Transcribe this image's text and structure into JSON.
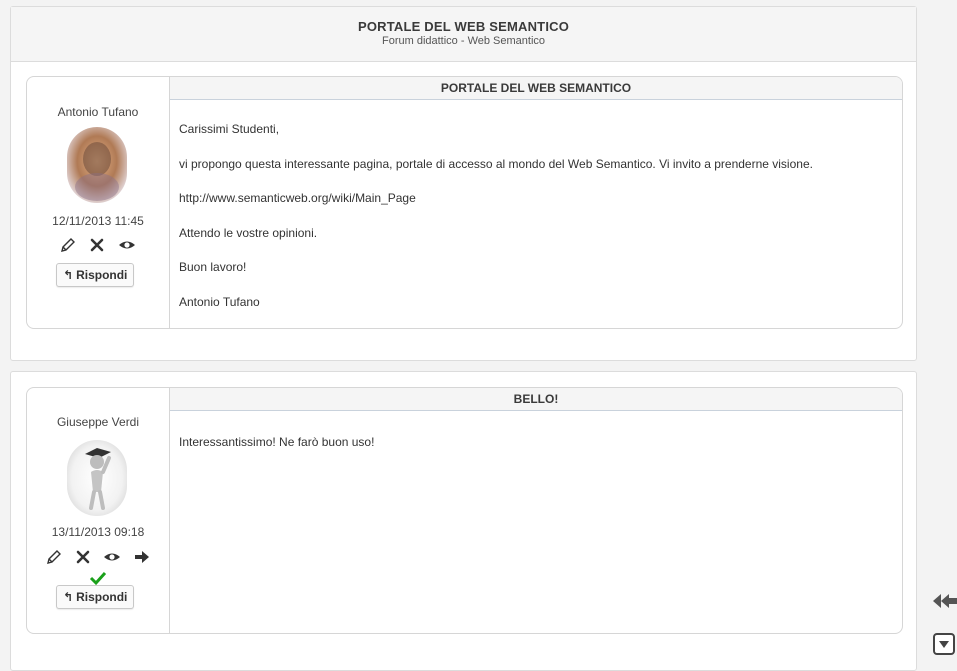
{
  "forum": {
    "title": "PORTALE DEL WEB SEMANTICO",
    "subtitle": "Forum didattico - Web Semantico"
  },
  "posts": [
    {
      "author": "Antonio Tufano",
      "date": "12/11/2013 11:45",
      "title": "PORTALE DEL WEB SEMANTICO",
      "reply_label": "Rispondi",
      "actions": [
        "pencil-icon",
        "delete-icon",
        "eye-icon"
      ],
      "body": [
        "Carissimi Studenti,",
        "vi propongo questa interessante pagina, portale di accesso al mondo del Web Semantico. Vi invito a prenderne visione.",
        "http://www.semanticweb.org/wiki/Main_Page",
        "Attendo le vostre opinioni.",
        "Buon lavoro!",
        "Antonio Tufano"
      ]
    },
    {
      "author": "Giuseppe Verdi",
      "date": "13/11/2013 09:18",
      "title": "BELLO!",
      "reply_label": "Rispondi",
      "actions": [
        "pencil-icon",
        "delete-icon",
        "eye-icon",
        "arrow-right-icon",
        "check-icon"
      ],
      "body": [
        "Interessantissimo! Ne farò buon uso!"
      ]
    }
  ],
  "colors": {
    "check": "#1aa01a",
    "border": "#d6d6d6",
    "header_bg": "#f5f5f5"
  }
}
